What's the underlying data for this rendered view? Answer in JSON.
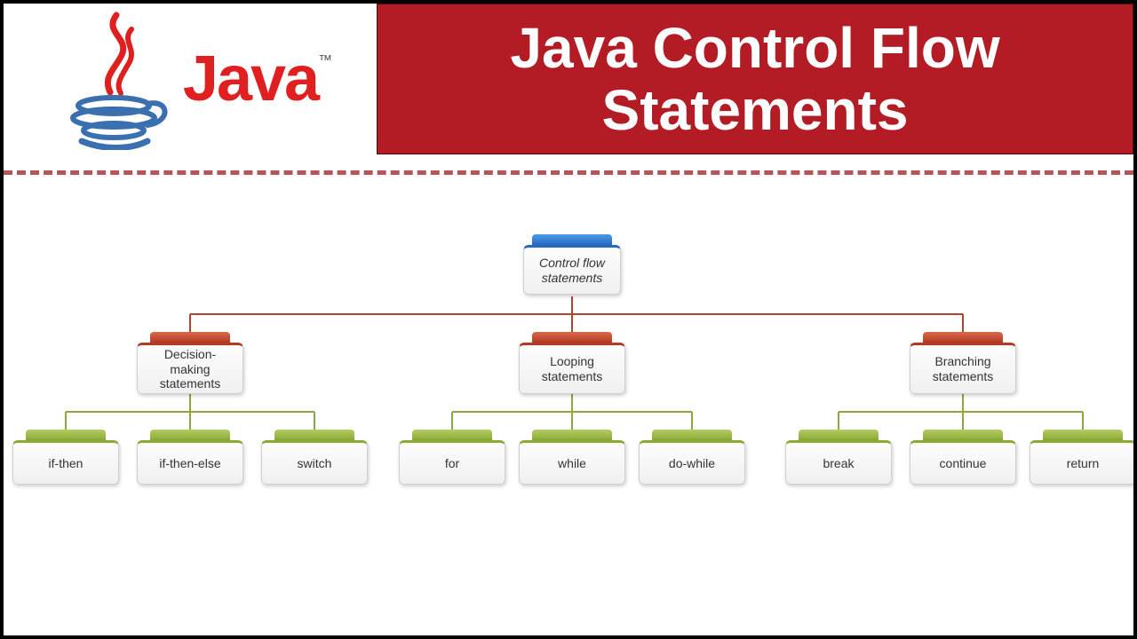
{
  "header": {
    "logo_label": "Java",
    "title": "Java Control Flow Statements"
  },
  "diagram": {
    "root": {
      "label": "Control flow statements"
    },
    "categories": [
      {
        "label": "Decision-making statements",
        "leaves": [
          {
            "label": "if-then"
          },
          {
            "label": "if-then-else"
          },
          {
            "label": "switch"
          }
        ]
      },
      {
        "label": "Looping statements",
        "leaves": [
          {
            "label": "for"
          },
          {
            "label": "while"
          },
          {
            "label": "do-while"
          }
        ]
      },
      {
        "label": "Branching statements",
        "leaves": [
          {
            "label": "break"
          },
          {
            "label": "continue"
          },
          {
            "label": "return"
          }
        ]
      }
    ]
  },
  "colors": {
    "banner": "#b31c24",
    "root_tab": "#2669c1",
    "category_tab": "#b63a22",
    "leaf_tab": "#8aab33",
    "connector_root": "#b3432e",
    "connector_leaf": "#8aa83e"
  }
}
